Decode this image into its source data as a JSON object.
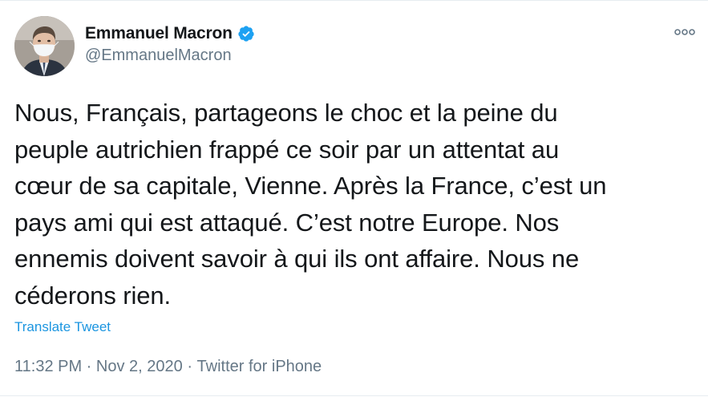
{
  "tweet": {
    "author": {
      "display_name": "Emmanuel Macron",
      "handle": "@EmmanuelMacron",
      "verified": true,
      "avatar_icon": "avatar-portrait-icon"
    },
    "text": "Nous, Français, partageons le choc et la peine du\npeuple autrichien frappé ce soir par un attentat au\ncœur de sa capitale, Vienne. Après la France, c’est un\npays ami qui est attaqué. C’est notre Europe. Nos\nennemis doivent savoir à qui ils ont affaire. Nous ne\ncéderons rien.",
    "translate_label": "Translate Tweet",
    "time": "11:32 PM",
    "separator": " · ",
    "date": "Nov 2, 2020",
    "source": "Twitter for iPhone"
  },
  "icons": {
    "verified": "verified-badge-icon",
    "more": "more-options-icon"
  },
  "colors": {
    "text_primary": "#14171a",
    "text_secondary": "#657786",
    "link": "#1b95e0",
    "verified": "#1da1f2",
    "border": "#e6ecf0"
  }
}
